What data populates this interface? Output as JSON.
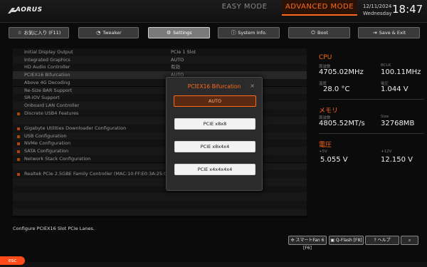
{
  "header": {
    "brand": "AORUS",
    "mode_easy": "EASY MODE",
    "mode_advanced": "ADVANCED MODE",
    "date": "12/11/2024",
    "weekday": "Wednesday",
    "time": "18:47",
    "accent_color": "#ff6a1a"
  },
  "tabs": [
    {
      "label": "お気に入り (F11)",
      "icon": "star-icon"
    },
    {
      "label": "Tweaker",
      "icon": "gauge-icon"
    },
    {
      "label": "Settings",
      "icon": "gear-icon"
    },
    {
      "label": "System Info.",
      "icon": "info-icon"
    },
    {
      "label": "Boot",
      "icon": "power-icon"
    },
    {
      "label": "Save & Exit",
      "icon": "exit-icon"
    }
  ],
  "settings": [
    {
      "label": "Initial Display Output",
      "value": "PCIe 1 Slot",
      "bullet": false
    },
    {
      "label": "Integrated Graphics",
      "value": "AUTO",
      "bullet": false
    },
    {
      "label": "HD Audio Controller",
      "value": "有効",
      "bullet": false
    },
    {
      "label": "PCIEX16 Bifurcation",
      "value": "AUTO",
      "bullet": false
    },
    {
      "label": "Above 4G Decoding",
      "value": "",
      "bullet": false
    },
    {
      "label": "Re-Size BAR Support",
      "value": "",
      "bullet": false
    },
    {
      "label": "SR-IOV Support",
      "value": "",
      "bullet": false
    },
    {
      "label": "Onboard LAN Controller",
      "value": "",
      "bullet": false
    },
    {
      "label": "Discrete USB4 Features",
      "value": "",
      "bullet": true
    },
    {
      "label": "",
      "value": "",
      "bullet": false
    },
    {
      "label": "Gigabyte Utilities Downloader Configuration",
      "value": "",
      "bullet": true
    },
    {
      "label": "USB Configuration",
      "value": "",
      "bullet": true
    },
    {
      "label": "NVMe Configuration",
      "value": "",
      "bullet": true
    },
    {
      "label": "SATA Configuration",
      "value": "",
      "bullet": true
    },
    {
      "label": "Network Stack Configuration",
      "value": "",
      "bullet": true
    },
    {
      "label": "",
      "value": "",
      "bullet": false
    },
    {
      "label": "Realtek PCIe 2.5GBE Family Controller (MAC:10:FF:E0:3A:25:08)",
      "value": "",
      "bullet": true
    }
  ],
  "sidebar": {
    "cpu": {
      "title": "CPU",
      "freq_label": "周波数",
      "freq_value": "4705.02MHz",
      "bclk_label": "BCLK",
      "bclk_value": "100.11MHz",
      "temp_label": "温度",
      "temp_value": "28.0 °C",
      "volt_label": "電圧",
      "volt_value": "1.044 V"
    },
    "memory": {
      "title": "メモリ",
      "freq_label": "周波数",
      "freq_value": "4805.52MT/s",
      "size_label": "Size",
      "size_value": "32768MB"
    },
    "voltage": {
      "title": "電圧",
      "v5_label": "+5V",
      "v5_value": "5.055 V",
      "v12_label": "+12V",
      "v12_value": "12.150 V"
    }
  },
  "status": "Configure PCIEX16 Slot PCIe Lanes.",
  "bottom_buttons": [
    {
      "label": "スマートFan 6 [F6]"
    },
    {
      "label": "Q-Flash [F8]"
    },
    {
      "label": "ヘルプ"
    },
    {
      "label": ""
    }
  ],
  "esc_label": "esc",
  "modal": {
    "title": "PCIEX16 Bifurcation",
    "close": "×",
    "options": [
      "AUTO",
      "PCIE x8x8",
      "PCIE x8x4x4",
      "PCIE x4x4x4x4"
    ],
    "selected": "AUTO"
  }
}
